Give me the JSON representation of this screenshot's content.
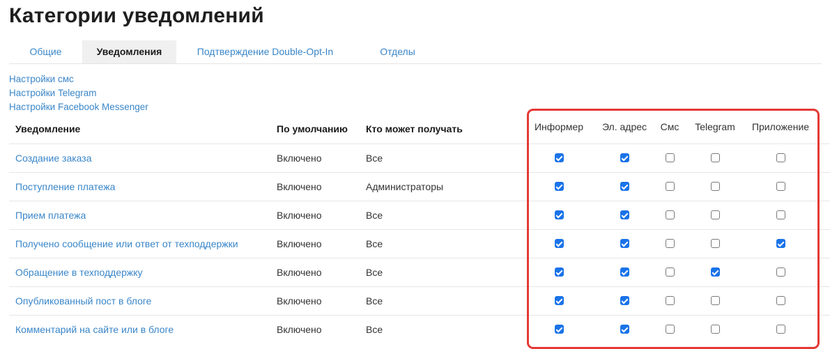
{
  "page": {
    "title": "Категории уведомлений"
  },
  "tabs": [
    {
      "label": "Общие",
      "active": false
    },
    {
      "label": "Уведомления",
      "active": true
    },
    {
      "label": "Подтверждение Double-Opt-In",
      "active": false
    },
    {
      "label": "Отделы",
      "active": false
    }
  ],
  "settings_links": [
    "Настройки смс",
    "Настройки Telegram",
    "Настройки Facebook Messenger"
  ],
  "table": {
    "headers": {
      "notification": "Уведомление",
      "default": "По умолчанию",
      "recipients": "Кто может получать",
      "channels": [
        "Информер",
        "Эл. адрес",
        "Смс",
        "Telegram",
        "Приложение"
      ]
    },
    "rows": [
      {
        "name": "Создание заказа",
        "default": "Включено",
        "recipients": "Все",
        "channels": [
          true,
          true,
          false,
          false,
          false
        ]
      },
      {
        "name": "Поступление платежа",
        "default": "Включено",
        "recipients": "Администраторы",
        "channels": [
          true,
          true,
          false,
          false,
          false
        ]
      },
      {
        "name": "Прием платежа",
        "default": "Включено",
        "recipients": "Все",
        "channels": [
          true,
          true,
          false,
          false,
          false
        ]
      },
      {
        "name": "Получено сообщение или ответ от техподдержки",
        "default": "Включено",
        "recipients": "Все",
        "channels": [
          true,
          true,
          false,
          false,
          true
        ]
      },
      {
        "name": "Обращение в техподдержку",
        "default": "Включено",
        "recipients": "Все",
        "channels": [
          true,
          true,
          false,
          true,
          false
        ]
      },
      {
        "name": "Опубликованный пост в блоге",
        "default": "Включено",
        "recipients": "Все",
        "channels": [
          true,
          true,
          false,
          false,
          false
        ]
      },
      {
        "name": "Комментарий на сайте или в блоге",
        "default": "Включено",
        "recipients": "Все",
        "channels": [
          true,
          true,
          false,
          false,
          false
        ]
      }
    ]
  },
  "colors": {
    "link": "#3a86c8",
    "checkbox_checked": "#1a73e8",
    "highlight_border": "#e53935",
    "active_tab_bg": "#f0f0f0"
  }
}
